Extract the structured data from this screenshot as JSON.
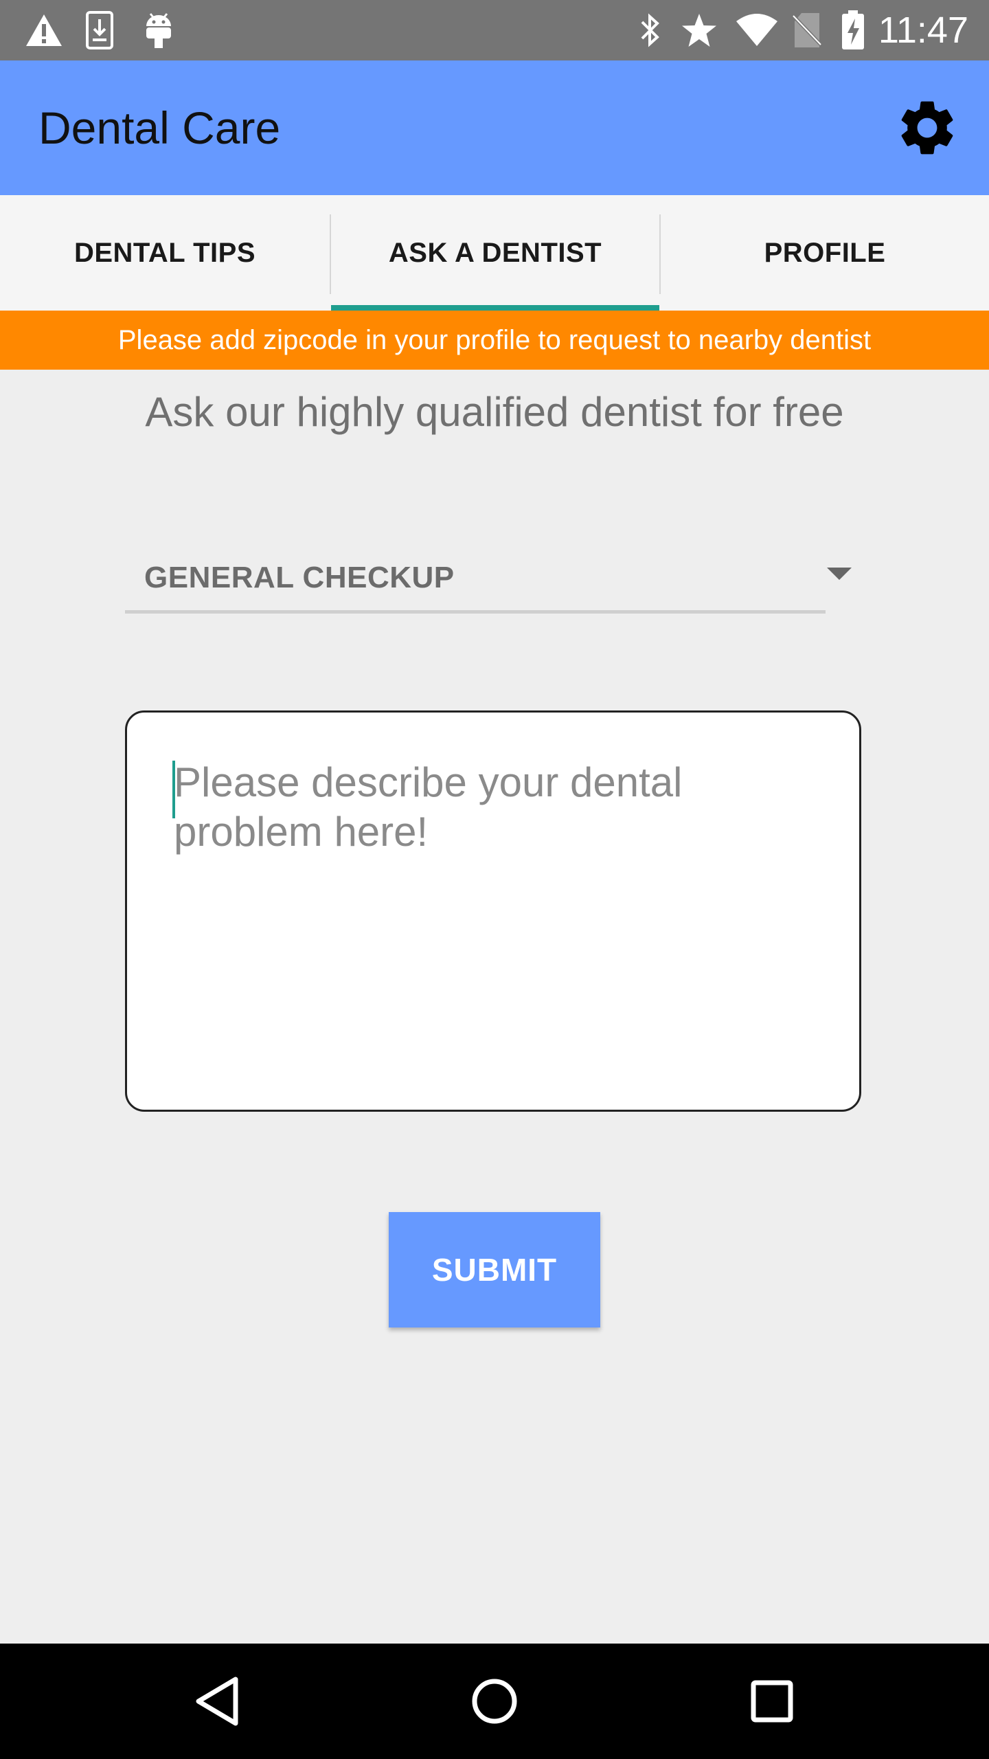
{
  "status_bar": {
    "time": "11:47",
    "left_icons": [
      "warning-icon",
      "download-icon",
      "android-icon"
    ],
    "right_icons": [
      "bluetooth-icon",
      "star-icon",
      "wifi-icon",
      "no-sim-icon",
      "battery-charging-icon"
    ]
  },
  "app_bar": {
    "title": "Dental Care",
    "settings_icon": "gear-icon",
    "background": "#6699ff"
  },
  "tabs": [
    {
      "label": "DENTAL TIPS",
      "selected": false
    },
    {
      "label": "ASK A DENTIST",
      "selected": true
    },
    {
      "label": "PROFILE",
      "selected": false
    }
  ],
  "banner": {
    "text": "Please add zipcode in your profile to request to nearby dentist",
    "color": "#ff8800"
  },
  "main": {
    "heading": "Ask our highly qualified dentist for free",
    "category_spinner": {
      "value": "GENERAL CHECKUP"
    },
    "description": {
      "placeholder": "Please describe your dental problem here!",
      "value": ""
    },
    "submit_label": "SUBMIT"
  },
  "nav_bar": {
    "buttons": [
      "back-icon",
      "home-icon",
      "recents-icon"
    ]
  },
  "colors": {
    "accent": "#1f9e8e",
    "primary": "#6699ff",
    "warning": "#ff8800"
  }
}
